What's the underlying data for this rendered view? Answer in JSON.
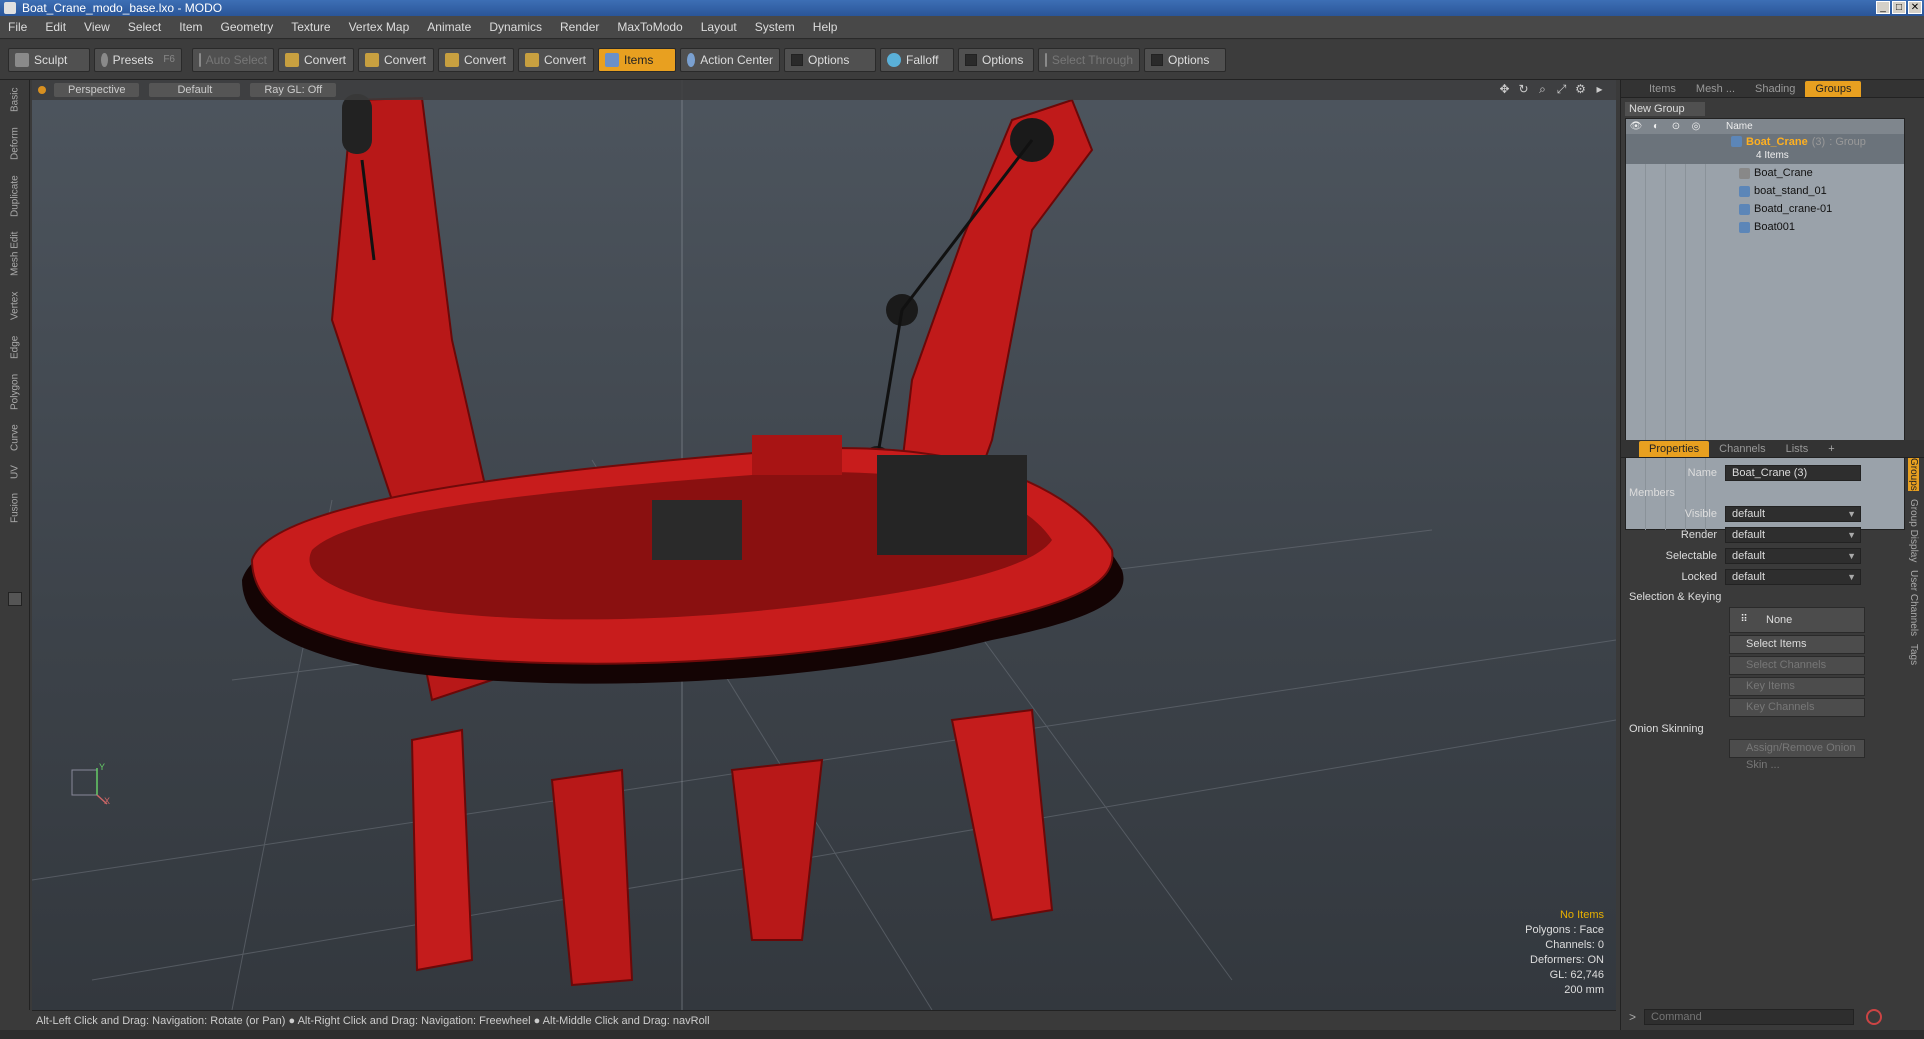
{
  "window": {
    "title": "Boat_Crane_modo_base.lxo - MODO",
    "controls": [
      "_",
      "□",
      "✕"
    ]
  },
  "menu": [
    "File",
    "Edit",
    "View",
    "Select",
    "Item",
    "Geometry",
    "Texture",
    "Vertex Map",
    "Animate",
    "Dynamics",
    "Render",
    "MaxToModo",
    "Layout",
    "System",
    "Help"
  ],
  "toolbar": {
    "sculpt": "Sculpt",
    "presets": "Presets",
    "presets_key": "F6",
    "auto_select": "Auto Select",
    "convert1": "Convert",
    "convert2": "Convert",
    "convert3": "Convert",
    "convert4": "Convert",
    "items": "Items",
    "action_center": "Action Center",
    "options1": "Options",
    "falloff": "Falloff",
    "options2": "Options",
    "select_through": "Select Through",
    "options3": "Options"
  },
  "left_tabs": [
    "Basic",
    "Deform",
    "Duplicate",
    "Mesh Edit",
    "Vertex",
    "Edge",
    "Polygon",
    "Curve",
    "UV",
    "Fusion"
  ],
  "viewport": {
    "view": "Perspective",
    "shading": "Default",
    "raygl": "Ray GL: Off",
    "hud": {
      "no_items": "No Items",
      "polygons": "Polygons : Face",
      "channels": "Channels: 0",
      "deformers": "Deformers: ON",
      "gl": "GL: 62,746",
      "scale": "200 mm"
    },
    "axis_labels": {
      "y": "Y",
      "x": "X"
    }
  },
  "status": "Alt-Left Click and Drag: Navigation: Rotate (or Pan) ● Alt-Right Click and Drag: Navigation: Freewheel ● Alt-Middle Click and Drag: navRoll",
  "groups_panel": {
    "tabs": [
      "Items",
      "Mesh ...",
      "Shading",
      "Groups"
    ],
    "active_tab": "Groups",
    "new_group": "New Group",
    "name_col": "Name",
    "group": {
      "name": "Boat_Crane",
      "count": "(3)",
      "type": ": Group",
      "sub": "4 Items"
    },
    "items": [
      "Boat_Crane",
      "boat_stand_01",
      "Boatd_crane-01",
      "Boat001"
    ]
  },
  "properties_panel": {
    "tabs": [
      "Properties",
      "Channels",
      "Lists",
      "+"
    ],
    "name_label": "Name",
    "name_value": "Boat_Crane (3)",
    "members": "Members",
    "visible_label": "Visible",
    "visible_value": "default",
    "render_label": "Render",
    "render_value": "default",
    "selectable_label": "Selectable",
    "selectable_value": "default",
    "locked_label": "Locked",
    "locked_value": "default",
    "selection_keying": "Selection & Keying",
    "none_btn": "None",
    "select_items": "Select Items",
    "select_channels": "Select Channels",
    "key_items": "Key Items",
    "key_channels": "Key Channels",
    "onion_skinning": "Onion Skinning",
    "assign_onion": "Assign/Remove Onion Skin ...",
    "vertical_tabs": [
      "Groups",
      "Group Display",
      "User Channels",
      "Tags"
    ]
  },
  "command": {
    "placeholder": "Command"
  }
}
